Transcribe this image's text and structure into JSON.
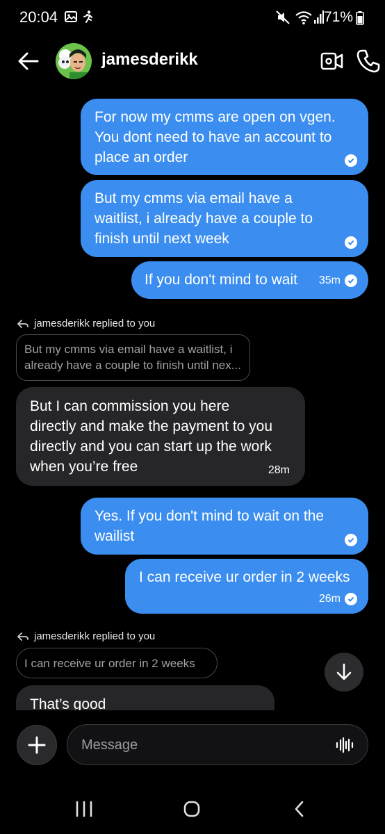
{
  "status_bar": {
    "time": "20:04",
    "battery": "71%"
  },
  "header": {
    "username": "jamesderikk"
  },
  "messages": [
    {
      "from": "me",
      "lines": [
        "For now my cmms are open on vgen.",
        "You dont need to have an account to",
        "place an order"
      ],
      "time": ""
    },
    {
      "from": "me",
      "lines": [
        "But my cmms via email have a",
        "waitlist,  i already have a couple to",
        "finish until next week"
      ],
      "time": ""
    },
    {
      "from": "me",
      "lines": [
        "If you don't mind to wait"
      ],
      "time": "35m"
    },
    {
      "from": "them",
      "reply_label": "jamesderikk replied to you",
      "quote_lines": [
        "But my cmms via email have a waitlist,  i",
        "already have a couple to finish until nex..."
      ]
    },
    {
      "from": "them",
      "lines": [
        "But I can commission you here",
        "directly and make the payment to you",
        "directly and you can start up the work",
        "when you’re free"
      ],
      "time": "28m"
    },
    {
      "from": "me",
      "lines": [
        "Yes. If you don't mind to wait on the",
        "wailist"
      ],
      "time": ""
    },
    {
      "from": "me",
      "lines": [
        "I can receive ur order in 2 weeks"
      ],
      "time": "26m"
    },
    {
      "from": "them",
      "reply_label": "jamesderikk replied to you",
      "quote_lines": [
        "I can receive ur order in 2 weeks"
      ]
    },
    {
      "from": "them",
      "lines": [
        "That’s good"
      ],
      "time": ""
    }
  ],
  "composer": {
    "placeholder": "Message"
  },
  "colors": {
    "outgoing_bubble": "#3b8ef0",
    "incoming_bubble": "#262629",
    "background": "#000000"
  },
  "icons": [
    "back-arrow-icon",
    "video-call-icon",
    "phone-icon",
    "reply-arrow-icon",
    "seen-check-icon",
    "scroll-down-arrow-icon",
    "plus-icon",
    "voice-waveform-icon",
    "gallery-icon",
    "running-icon",
    "mute-icon",
    "wifi-icon",
    "signal-icon",
    "battery-icon",
    "nav-recents-icon",
    "nav-home-icon",
    "nav-back-icon"
  ]
}
